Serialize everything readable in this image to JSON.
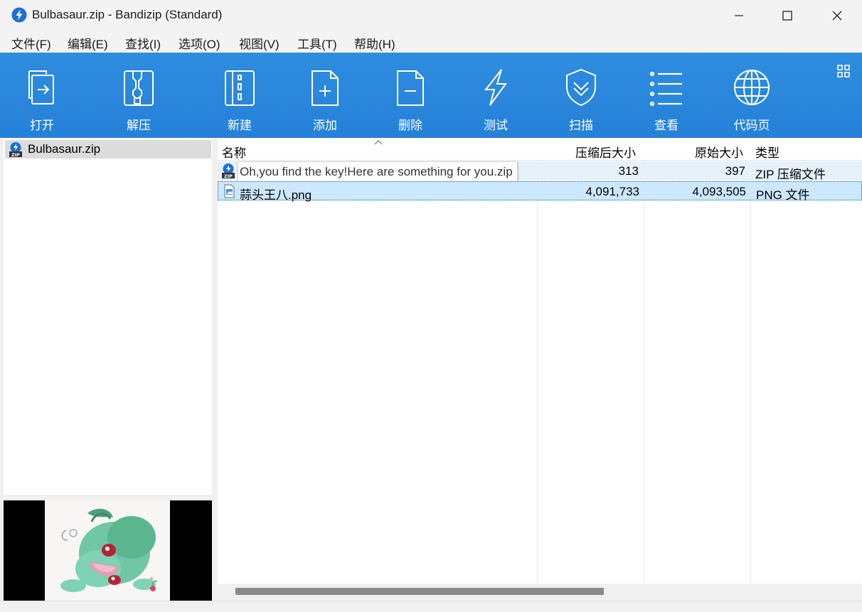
{
  "window": {
    "title": "Bulbasaur.zip - Bandizip (Standard)",
    "controls": [
      "minimize-icon",
      "maximize-icon",
      "close-icon"
    ]
  },
  "menu": [
    "文件(F)",
    "编辑(E)",
    "查找(I)",
    "选项(O)",
    "视图(V)",
    "工具(T)",
    "帮助(H)"
  ],
  "toolbar": {
    "items": [
      {
        "label": "打开",
        "icon": "open-icon"
      },
      {
        "label": "解压",
        "icon": "extract-icon"
      },
      {
        "label": "新建",
        "icon": "new-archive-icon"
      },
      {
        "label": "添加",
        "icon": "add-file-icon"
      },
      {
        "label": "删除",
        "icon": "delete-file-icon"
      },
      {
        "label": "测试",
        "icon": "test-lightning-icon"
      },
      {
        "label": "扫描",
        "icon": "scan-shield-icon"
      },
      {
        "label": "查看",
        "icon": "view-list-icon"
      },
      {
        "label": "代码页",
        "icon": "codepage-globe-icon"
      }
    ]
  },
  "tree": {
    "root": "Bulbasaur.zip"
  },
  "list": {
    "columns": [
      "名称",
      "压缩后大小",
      "原始大小",
      "类型"
    ],
    "rows": [
      {
        "name": "Oh,you find the key!Here are something for you.zip",
        "packed": "313",
        "original": "397",
        "type": "ZIP 压缩文件",
        "icon": "zip-file-icon"
      },
      {
        "name": "蒜头王八.png",
        "packed": "4,091,733",
        "original": "4,093,505",
        "type": "PNG 文件",
        "icon": "png-file-icon"
      }
    ]
  },
  "colors": {
    "toolbar": "#2f8de0",
    "selection": "#cce8ff",
    "hover": "#e5f1fb"
  }
}
